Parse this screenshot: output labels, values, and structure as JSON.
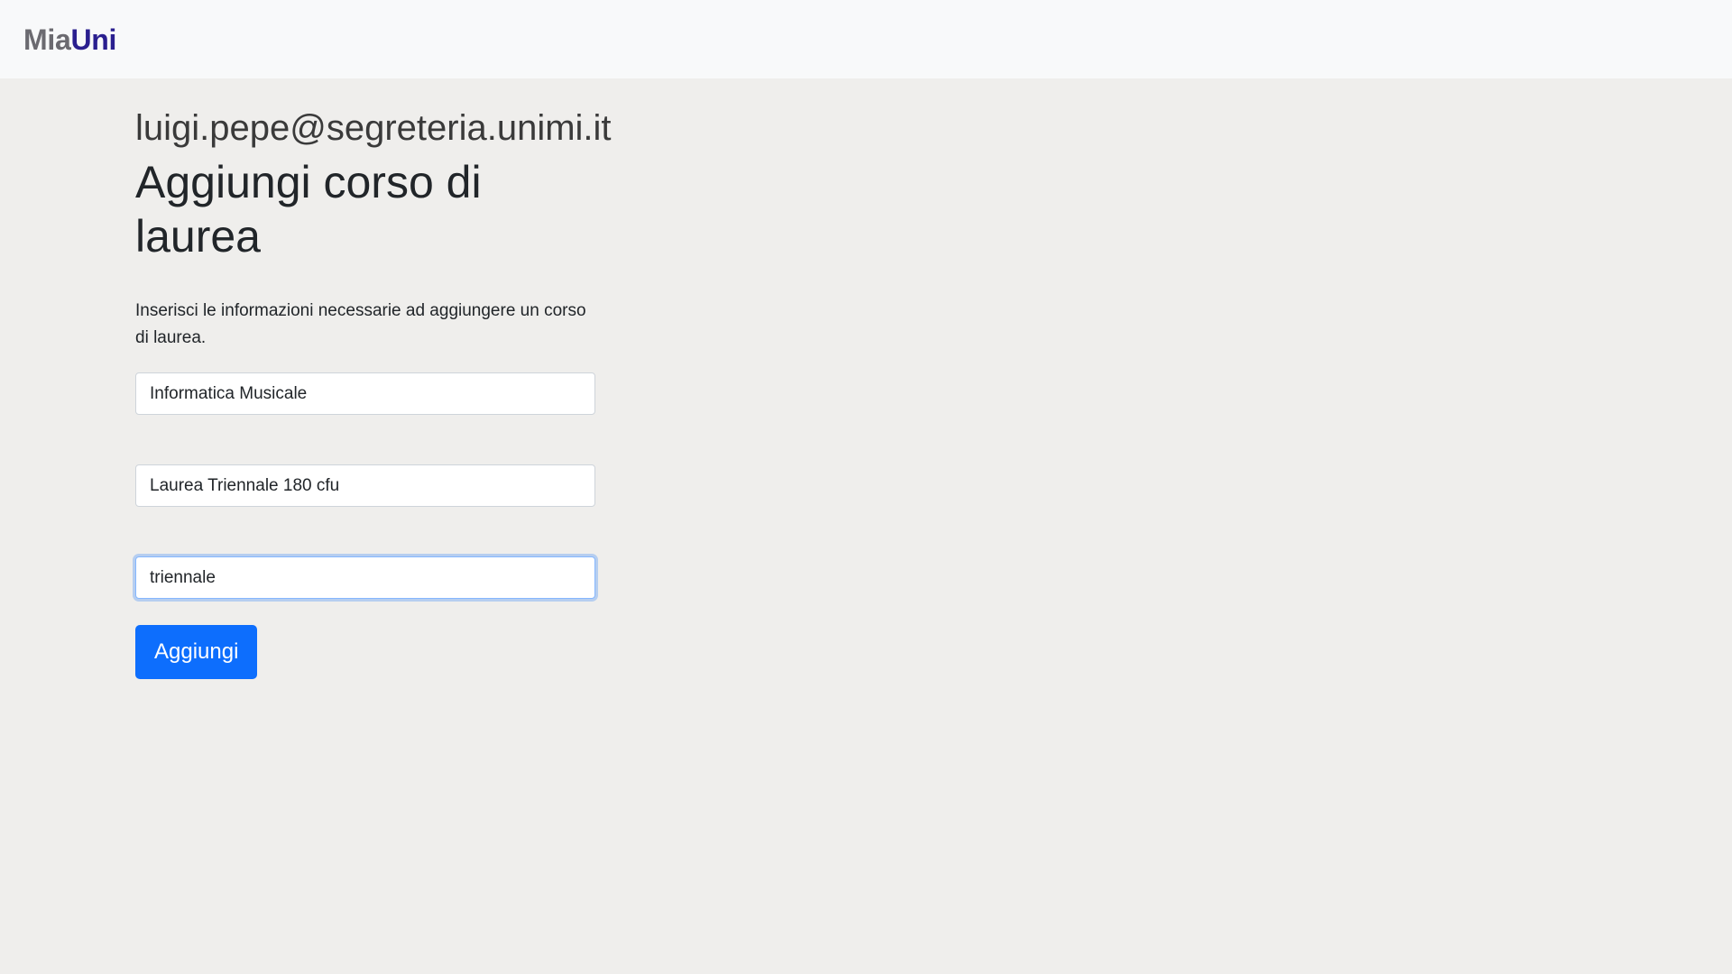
{
  "navbar": {
    "brand_part1": "Mia",
    "brand_part2": "Uni"
  },
  "main": {
    "user_email": "luigi.pepe@segreteria.unimi.it",
    "title": "Aggiungi corso di laurea",
    "description": "Inserisci le informazioni necessarie ad aggiungere un corso di laurea.",
    "fields": [
      {
        "value": "Informatica Musicale",
        "focused": false
      },
      {
        "value": "Laurea Triennale 180 cfu",
        "focused": false
      },
      {
        "value": "triennale",
        "focused": true
      }
    ],
    "submit_label": "Aggiungi"
  },
  "colors": {
    "brand_mia": "#6b6a70",
    "brand_uni": "#2a1f8f",
    "primary_button": "#0d6efd",
    "page_background": "#efeeec",
    "navbar_background": "#f8f9fa",
    "focus_border": "#86b7fe"
  }
}
